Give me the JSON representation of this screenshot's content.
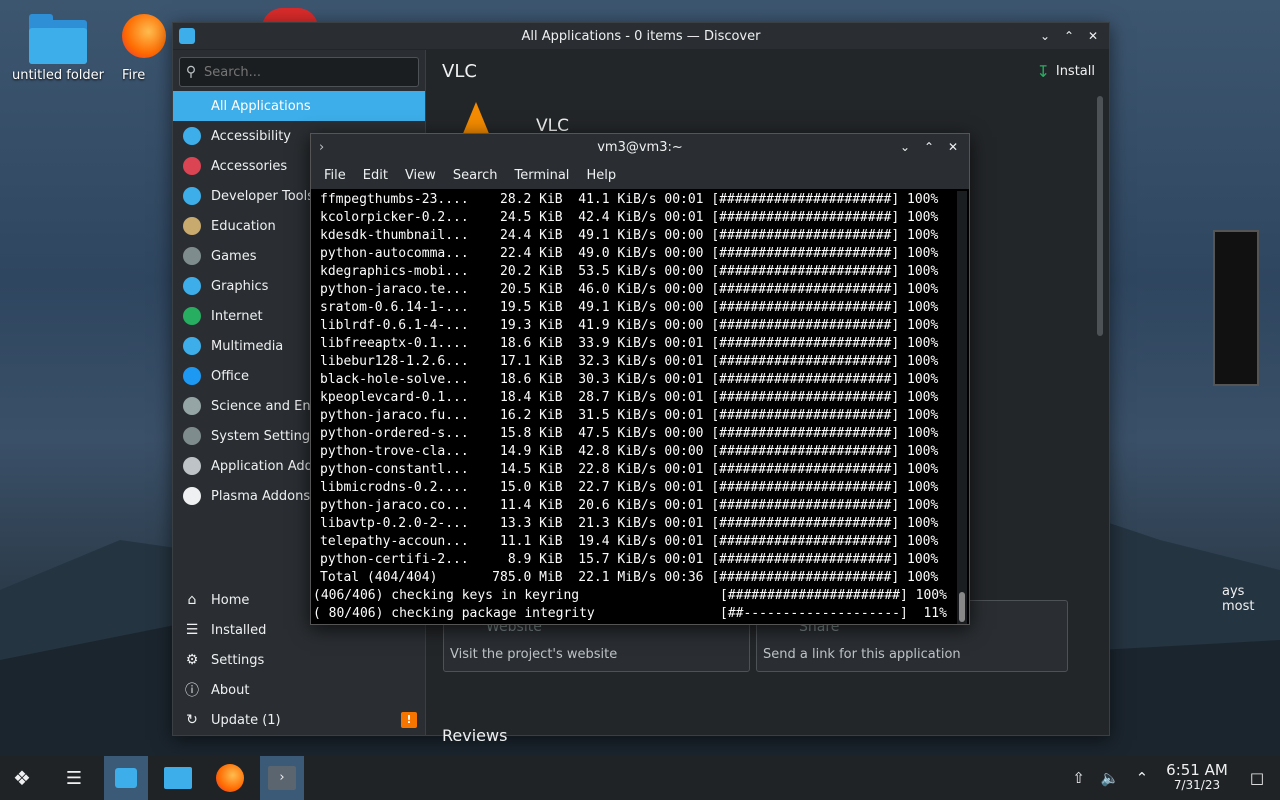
{
  "desktop": {
    "icons": [
      {
        "label": "untitled folder"
      },
      {
        "label": "Fire"
      }
    ]
  },
  "discover": {
    "window_title": "All Applications - 0 items — Discover",
    "search_placeholder": "Search...",
    "categories": [
      {
        "label": "All Applications",
        "icon": "grid-icon",
        "color": "#3daee9"
      },
      {
        "label": "Accessibility",
        "icon": "accessibility-icon",
        "color": "#3daee9"
      },
      {
        "label": "Accessories",
        "icon": "toolbox-icon",
        "color": "#da4453"
      },
      {
        "label": "Developer Tools",
        "icon": "developer-icon",
        "color": "#3daee9"
      },
      {
        "label": "Education",
        "icon": "education-icon",
        "color": "#c8a96e"
      },
      {
        "label": "Games",
        "icon": "gamepad-icon",
        "color": "#7f8c8d"
      },
      {
        "label": "Graphics",
        "icon": "graphics-icon",
        "color": "#3daee9"
      },
      {
        "label": "Internet",
        "icon": "globe-icon",
        "color": "#27ae60"
      },
      {
        "label": "Multimedia",
        "icon": "multimedia-icon",
        "color": "#3daee9"
      },
      {
        "label": "Office",
        "icon": "office-icon",
        "color": "#1d99f3"
      },
      {
        "label": "Science and Eng",
        "icon": "science-icon",
        "color": "#95a5a6"
      },
      {
        "label": "System Settings",
        "icon": "settings-icon",
        "color": "#7f8c8d"
      },
      {
        "label": "Application Addo",
        "icon": "addons-icon",
        "color": "#bdc3c7"
      },
      {
        "label": "Plasma Addons",
        "icon": "plasma-icon",
        "color": "#eff0f1"
      }
    ],
    "bottom_nav": [
      {
        "label": "Home",
        "icon": "home-icon"
      },
      {
        "label": "Installed",
        "icon": "installed-icon"
      },
      {
        "label": "Settings",
        "icon": "settings-icon"
      },
      {
        "label": "About",
        "icon": "info-icon"
      },
      {
        "label": "Update (1)",
        "icon": "update-icon",
        "badge": "!"
      }
    ],
    "page_title": "VLC",
    "install_label": "Install",
    "app_name": "VLC",
    "website_card": {
      "title": "Website",
      "desc": "Visit the project's website"
    },
    "share_card": {
      "title": "Share",
      "desc": "Send a link for this application"
    },
    "reviews_heading": "Reviews",
    "description_fragment": "ays most"
  },
  "terminal": {
    "window_title": "vm3@vm3:~",
    "menu": [
      "File",
      "Edit",
      "View",
      "Search",
      "Terminal",
      "Help"
    ],
    "lines": [
      "ffmpegthumbs-23....    28.2 KiB  41.1 KiB/s 00:01 [######################] 100%",
      "kcolorpicker-0.2...    24.5 KiB  42.4 KiB/s 00:01 [######################] 100%",
      "kdesdk-thumbnail...    24.4 KiB  49.1 KiB/s 00:00 [######################] 100%",
      "python-autocomma...    22.4 KiB  49.0 KiB/s 00:00 [######################] 100%",
      "kdegraphics-mobi...    20.2 KiB  53.5 KiB/s 00:00 [######################] 100%",
      "python-jaraco.te...    20.5 KiB  46.0 KiB/s 00:00 [######################] 100%",
      "sratom-0.6.14-1-...    19.5 KiB  49.1 KiB/s 00:00 [######################] 100%",
      "liblrdf-0.6.1-4-...    19.3 KiB  41.9 KiB/s 00:00 [######################] 100%",
      "libfreeaptx-0.1....    18.6 KiB  33.9 KiB/s 00:01 [######################] 100%",
      "libebur128-1.2.6...    17.1 KiB  32.3 KiB/s 00:01 [######################] 100%",
      "black-hole-solve...    18.6 KiB  30.3 KiB/s 00:01 [######################] 100%",
      "kpeoplevcard-0.1...    18.4 KiB  28.7 KiB/s 00:01 [######################] 100%",
      "python-jaraco.fu...    16.2 KiB  31.5 KiB/s 00:01 [######################] 100%",
      "python-ordered-s...    15.8 KiB  47.5 KiB/s 00:00 [######################] 100%",
      "python-trove-cla...    14.9 KiB  42.8 KiB/s 00:00 [######################] 100%",
      "python-constantl...    14.5 KiB  22.8 KiB/s 00:01 [######################] 100%",
      "libmicrodns-0.2....    15.0 KiB  22.7 KiB/s 00:01 [######################] 100%",
      "python-jaraco.co...    11.4 KiB  20.6 KiB/s 00:01 [######################] 100%",
      "libavtp-0.2.0-2-...    13.3 KiB  21.3 KiB/s 00:01 [######################] 100%",
      "telepathy-accoun...    11.1 KiB  19.4 KiB/s 00:01 [######################] 100%",
      "python-certifi-2...     8.9 KiB  15.7 KiB/s 00:01 [######################] 100%",
      "Total (404/404)       785.0 MiB  22.1 MiB/s 00:36 [######################] 100%"
    ],
    "status_lines": [
      "(406/406) checking keys in keyring                  [######################] 100%",
      "( 80/406) checking package integrity                [##--------------------]  11%"
    ]
  },
  "taskbar": {
    "clock_time": "6:51 AM",
    "clock_date": "7/31/23"
  }
}
